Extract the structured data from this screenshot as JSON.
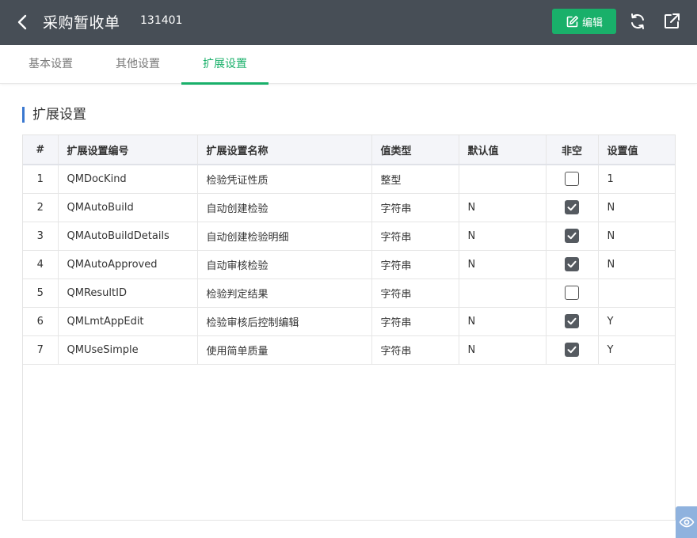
{
  "header": {
    "title": "采购暂收单",
    "doc_no": "131401",
    "edit_label": "编辑"
  },
  "tabs": [
    {
      "label": "基本设置",
      "active": false
    },
    {
      "label": "其他设置",
      "active": false
    },
    {
      "label": "扩展设置",
      "active": true
    }
  ],
  "section": {
    "title": "扩展设置"
  },
  "table": {
    "columns": [
      "#",
      "扩展设置编号",
      "扩展设置名称",
      "值类型",
      "默认值",
      "非空",
      "设置值"
    ],
    "rows": [
      {
        "idx": "1",
        "code": "QMDocKind",
        "name": "检验凭证性质",
        "type": "整型",
        "default": "",
        "not_null": false,
        "value": "1"
      },
      {
        "idx": "2",
        "code": "QMAutoBuild",
        "name": "自动创建检验",
        "type": "字符串",
        "default": "N",
        "not_null": true,
        "value": "N"
      },
      {
        "idx": "3",
        "code": "QMAutoBuildDetails",
        "name": "自动创建检验明细",
        "type": "字符串",
        "default": "N",
        "not_null": true,
        "value": "N"
      },
      {
        "idx": "4",
        "code": "QMAutoApproved",
        "name": "自动审核检验",
        "type": "字符串",
        "default": "N",
        "not_null": true,
        "value": "N"
      },
      {
        "idx": "5",
        "code": "QMResultID",
        "name": "检验判定结果",
        "type": "字符串",
        "default": "",
        "not_null": false,
        "value": ""
      },
      {
        "idx": "6",
        "code": "QMLmtAppEdit",
        "name": "检验审核后控制编辑",
        "type": "字符串",
        "default": "N",
        "not_null": true,
        "value": "Y"
      },
      {
        "idx": "7",
        "code": "QMUseSimple",
        "name": "使用简单质量",
        "type": "字符串",
        "default": "N",
        "not_null": true,
        "value": "Y"
      }
    ]
  },
  "colors": {
    "header_bg": "#474e56",
    "accent_green": "#19b06a",
    "section_bar": "#3a78d0",
    "checkbox_on": "#555a60",
    "eye_button": "#8fb2de"
  },
  "icons": {
    "back": "chevron-left-icon",
    "edit": "edit-icon",
    "refresh": "refresh-icon",
    "share": "share-icon",
    "checkbox": "check-icon",
    "view": "eye-icon"
  }
}
